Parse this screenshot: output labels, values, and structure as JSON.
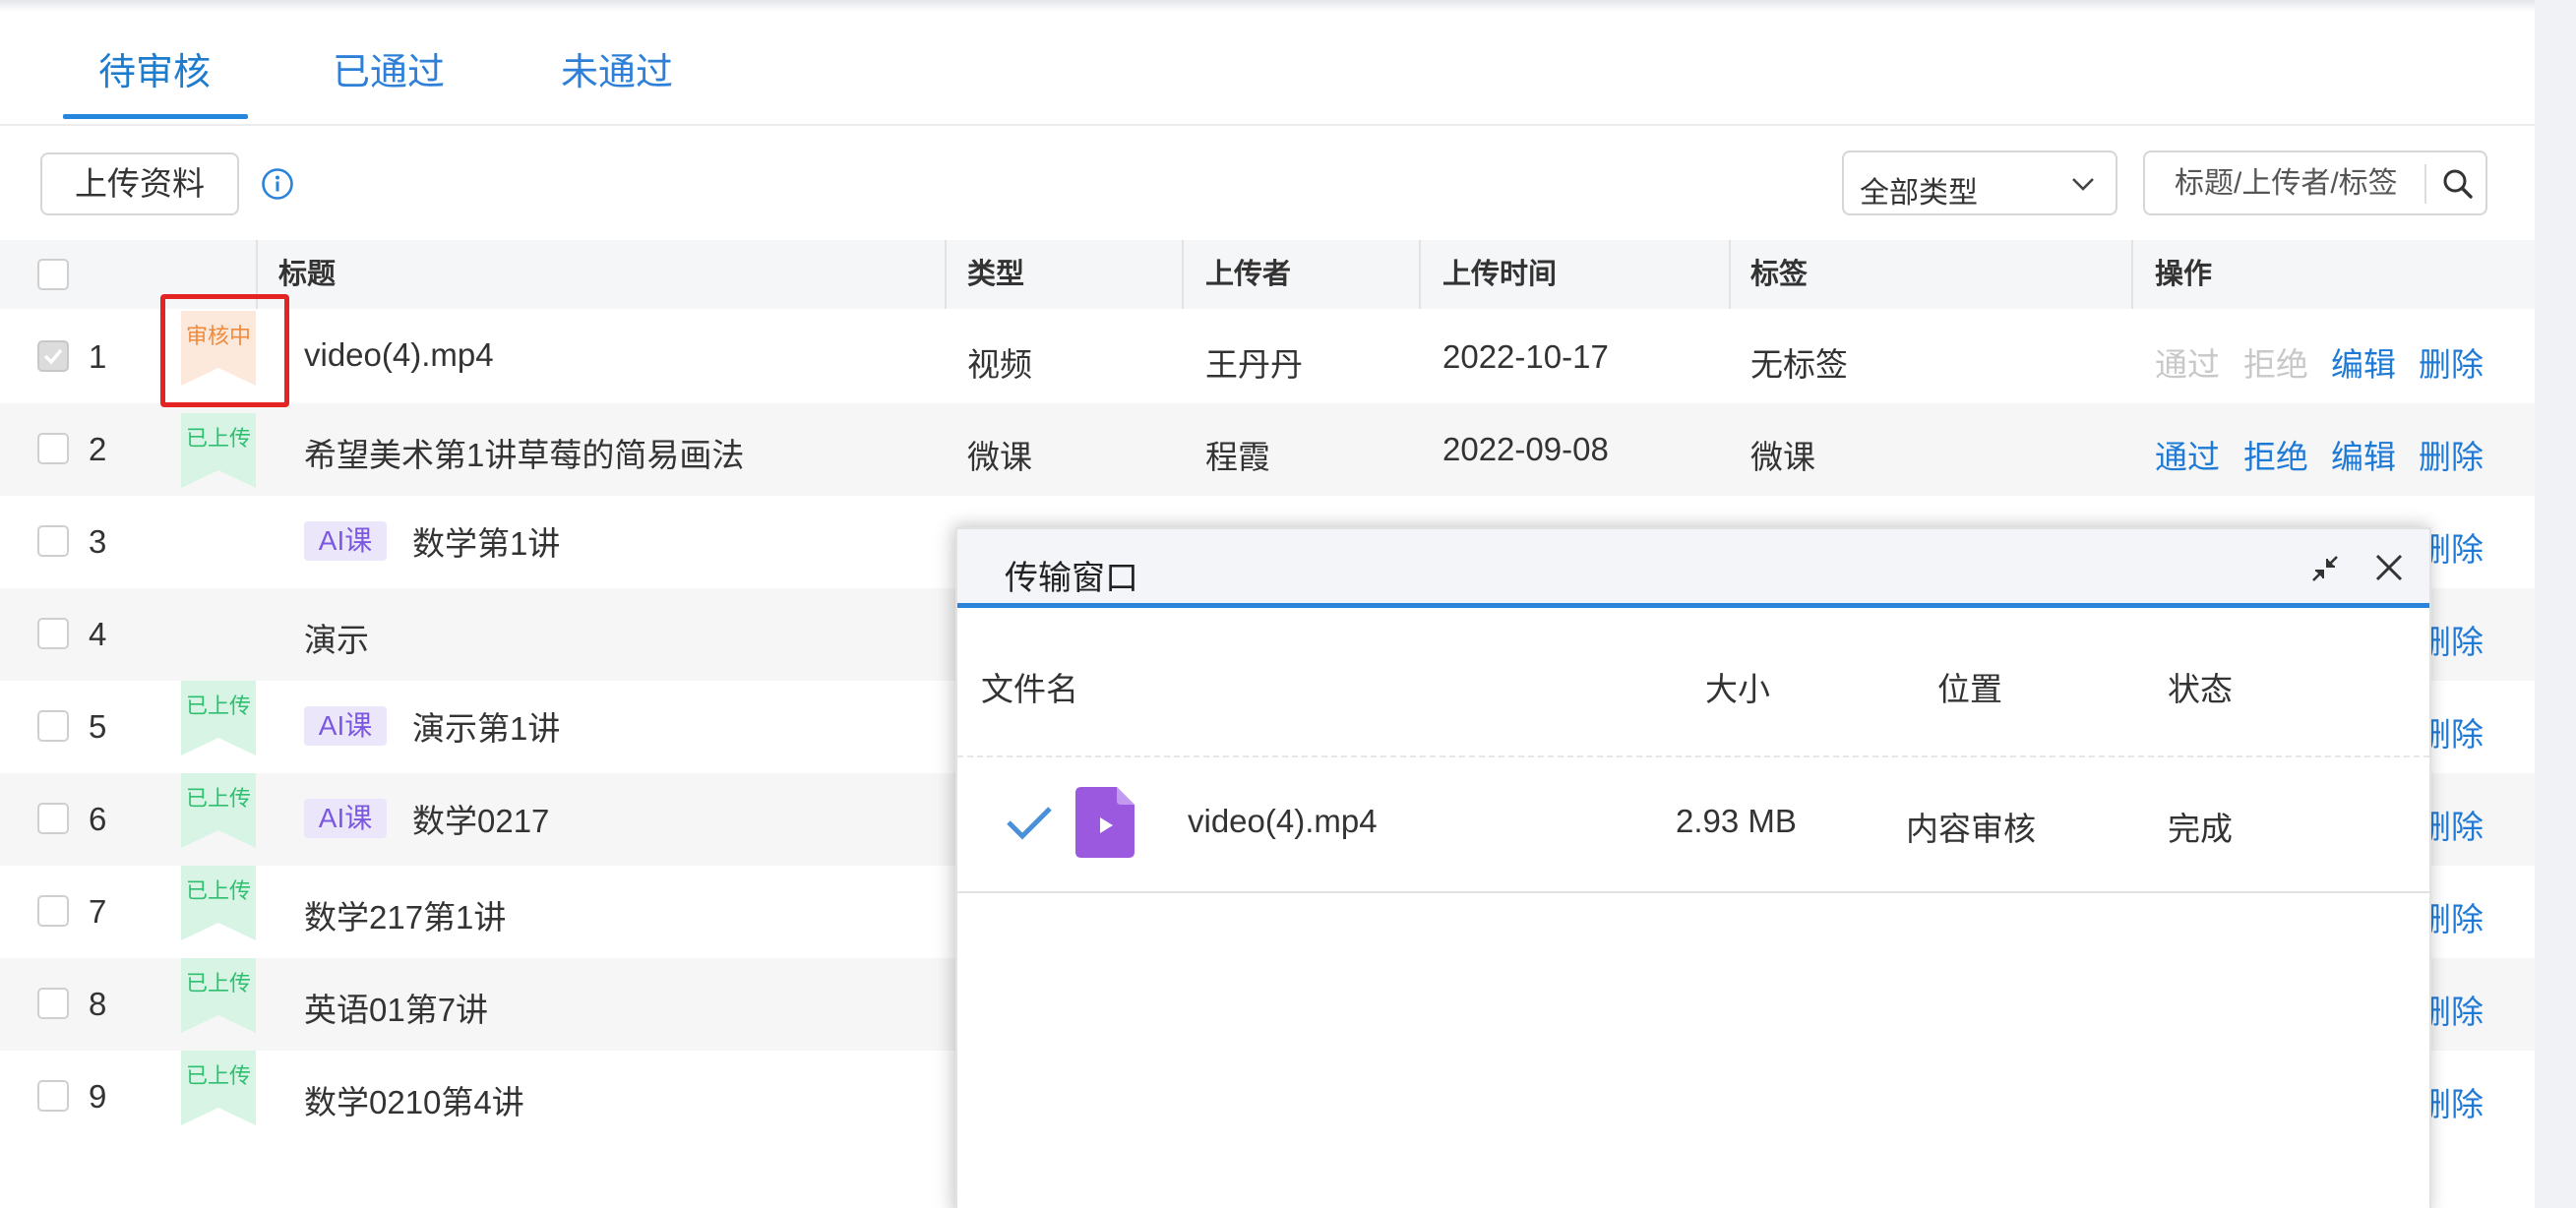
{
  "tabs": [
    {
      "label": "待审核",
      "active": true
    },
    {
      "label": "已通过",
      "active": false
    },
    {
      "label": "未通过",
      "active": false
    }
  ],
  "toolbar": {
    "upload_label": "上传资料",
    "info_icon": "info-icon",
    "type_filter_value": "全部类型",
    "search_placeholder": "标题/上传者/标签"
  },
  "table": {
    "columns": [
      "标题",
      "类型",
      "上传者",
      "上传时间",
      "标签",
      "操作"
    ],
    "rows": [
      {
        "idx": "1",
        "checked": true,
        "status": "审核中",
        "title": "video(4).mp4",
        "ai": "",
        "type": "视频",
        "uploader": "王丹丹",
        "time": "2022-10-17",
        "tag": "无标签",
        "ops": [
          "通过",
          "拒绝",
          "编辑",
          "删除"
        ],
        "pass_disabled": true
      },
      {
        "idx": "2",
        "checked": false,
        "status": "已上传",
        "title": "希望美术第1讲草莓的简易画法",
        "ai": "",
        "type": "微课",
        "uploader": "程霞",
        "time": "2022-09-08",
        "tag": "微课",
        "ops": [
          "通过",
          "拒绝",
          "编辑",
          "删除"
        ],
        "pass_disabled": false
      },
      {
        "idx": "3",
        "checked": false,
        "status": "",
        "title": "数学第1讲",
        "ai": "AI课",
        "type": "",
        "uploader": "",
        "time": "",
        "tag": "",
        "ops": [
          "删除"
        ]
      },
      {
        "idx": "4",
        "checked": false,
        "status": "",
        "title": "演示",
        "ai": "",
        "type": "",
        "uploader": "",
        "time": "",
        "tag": "",
        "ops": [
          "删除"
        ]
      },
      {
        "idx": "5",
        "checked": false,
        "status": "已上传",
        "title": "演示第1讲",
        "ai": "AI课",
        "type": "",
        "uploader": "",
        "time": "",
        "tag": "",
        "ops": [
          "删除"
        ]
      },
      {
        "idx": "6",
        "checked": false,
        "status": "已上传",
        "title": "数学0217",
        "ai": "AI课",
        "type": "",
        "uploader": "",
        "time": "",
        "tag": "",
        "ops": [
          "删除"
        ]
      },
      {
        "idx": "7",
        "checked": false,
        "status": "已上传",
        "title": "数学217第1讲",
        "ai": "",
        "type": "",
        "uploader": "",
        "time": "",
        "tag": "",
        "ops": [
          "删除"
        ]
      },
      {
        "idx": "8",
        "checked": false,
        "status": "已上传",
        "title": "英语01第7讲",
        "ai": "",
        "type": "",
        "uploader": "",
        "time": "",
        "tag": "",
        "ops": [
          "删除"
        ]
      },
      {
        "idx": "9",
        "checked": false,
        "status": "已上传",
        "title": "数学0210第4讲",
        "ai": "",
        "type": "",
        "uploader": "",
        "time": "",
        "tag": "",
        "ops": [
          "删除"
        ]
      }
    ]
  },
  "transfer_window": {
    "title": "传输窗口",
    "columns": [
      "文件名",
      "大小",
      "位置",
      "状态"
    ],
    "files": [
      {
        "name": "video(4).mp4",
        "size": "2.93 MB",
        "location": "内容审核",
        "status": "完成"
      }
    ]
  },
  "colors": {
    "accent": "#1f7ad6",
    "reviewing_badge": "#f08b3e",
    "uploaded_badge": "#2fbf71",
    "ai_tag_bg": "#ece6fb",
    "ai_tag_text": "#7b58e0",
    "highlight_box": "#e42323",
    "file_icon": "#9b59e0"
  }
}
